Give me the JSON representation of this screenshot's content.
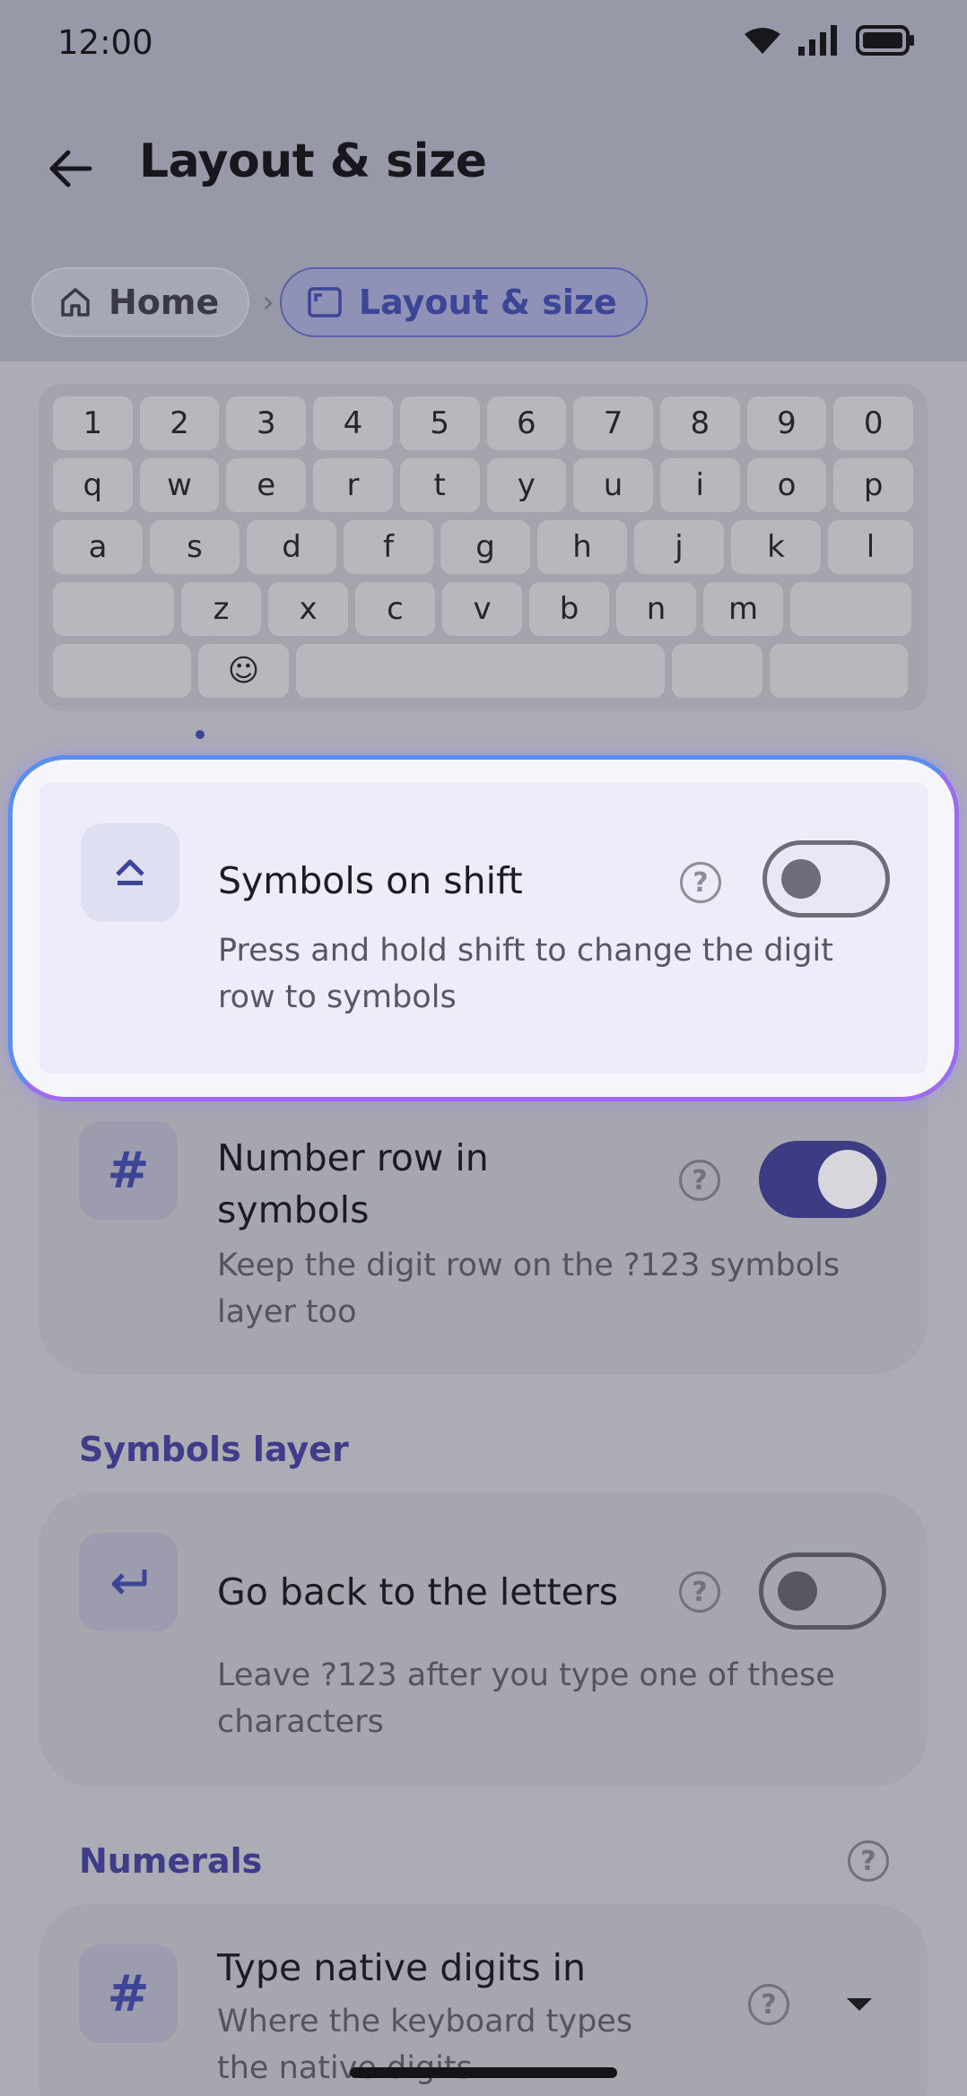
{
  "status": {
    "time": "12:00"
  },
  "appbar": {
    "title": "Layout & size"
  },
  "breadcrumb": {
    "home": "Home",
    "current": "Layout & size"
  },
  "keyboard": {
    "row1": [
      "1",
      "2",
      "3",
      "4",
      "5",
      "6",
      "7",
      "8",
      "9",
      "0"
    ],
    "row2": [
      "q",
      "w",
      "e",
      "r",
      "t",
      "y",
      "u",
      "i",
      "o",
      "p"
    ],
    "row3": [
      "a",
      "s",
      "d",
      "f",
      "g",
      "h",
      "j",
      "k",
      "l"
    ],
    "row4": [
      "z",
      "x",
      "c",
      "v",
      "b",
      "n",
      "m"
    ],
    "emoji": "☺"
  },
  "settings": {
    "symbols_on_shift": {
      "title": "Symbols on shift",
      "desc": "Press and hold shift to change the digit row to symbols",
      "enabled": false
    },
    "number_row": {
      "title": "Number row in symbols",
      "desc": "Keep the digit row on the ?123 symbols layer too",
      "enabled": true
    },
    "symbols_layer_header": "Symbols layer",
    "go_back": {
      "title": "Go back to the letters",
      "desc": "Leave ?123 after you type one of these characters",
      "enabled": false
    },
    "numerals_header": "Numerals",
    "native_digits": {
      "title": "Type native digits in",
      "desc": "Where the keyboard types the native digits"
    }
  },
  "icons": {
    "hash": "#",
    "help": "?"
  },
  "colors": {
    "accent": "#3d4596",
    "toggle_on": "#3e3b85",
    "highlight_border_start": "#5a8ff0",
    "highlight_border_end": "#a06af0"
  }
}
